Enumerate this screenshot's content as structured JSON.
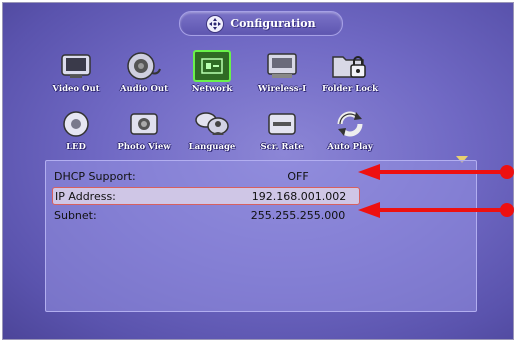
{
  "header": {
    "title": "Configuration",
    "icon": "navigation-pad-icon"
  },
  "menu": {
    "row1": [
      {
        "label": "Video Out",
        "icon": "tv-icon"
      },
      {
        "label": "Audio Out",
        "icon": "speaker-icon"
      },
      {
        "label": "Network",
        "icon": "network-icon",
        "selected": true
      },
      {
        "label": "Wireless-I",
        "icon": "wireless-icon"
      },
      {
        "label": "Folder Lock",
        "icon": "folder-lock-icon"
      }
    ],
    "row2": [
      {
        "label": "LED",
        "icon": "led-icon"
      },
      {
        "label": "Photo View",
        "icon": "camera-icon"
      },
      {
        "label": "Language",
        "icon": "language-icon"
      },
      {
        "label": "Scr. Rate",
        "icon": "screen-rate-icon"
      },
      {
        "label": "Auto Play",
        "icon": "auto-play-icon"
      }
    ]
  },
  "settings": [
    {
      "label": "DHCP Support:",
      "value": "OFF"
    },
    {
      "label": "IP Address:",
      "value": "192.168.001.002",
      "highlighted": true
    },
    {
      "label": "Subnet:",
      "value": "255.255.255.000"
    }
  ],
  "colors": {
    "annotation_arrow": "#ee1010",
    "selection": "#69f24a"
  }
}
